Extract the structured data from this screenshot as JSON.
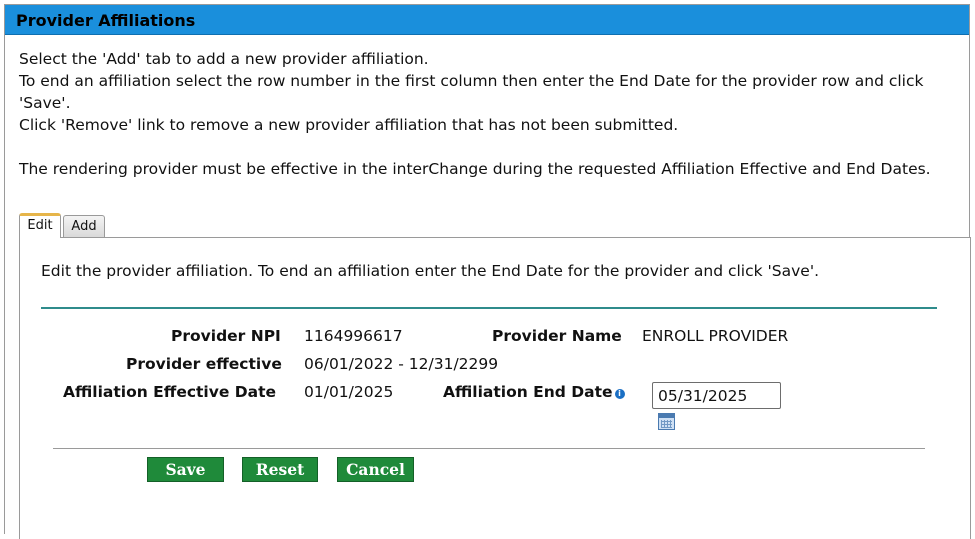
{
  "title": "Provider Affiliations",
  "intro": {
    "line1": "Select the 'Add' tab to add a new provider affiliation.",
    "line2": "To end an affiliation select the row number in the first column then enter the End Date for the provider row and click 'Save'.",
    "line3": "Click 'Remove' link to remove a new provider affiliation that has not been submitted.",
    "line4": "The rendering provider must be effective in the interChange during the requested Affiliation Effective and End Dates."
  },
  "tabs": {
    "edit": "Edit",
    "add": "Add"
  },
  "panel": {
    "description": "Edit the provider affiliation. To end an affiliation enter the End Date for the provider and click 'Save'.",
    "provider_npi_label": "Provider NPI",
    "provider_npi": "1164996617",
    "provider_name_label": "Provider Name",
    "provider_name": "ENROLL PROVIDER",
    "provider_effective_label": "Provider effective",
    "provider_effective": "06/01/2022 - 12/31/2299",
    "affiliation_effective_label": "Affiliation Effective Date",
    "affiliation_effective": "01/01/2025",
    "affiliation_end_label": "Affiliation End Date",
    "affiliation_end_value": "05/31/2025"
  },
  "buttons": {
    "save": "Save",
    "reset": "Reset",
    "cancel": "Cancel"
  },
  "icons": {
    "info": "info-icon",
    "calendar": "calendar-icon"
  },
  "colors": {
    "title_bar": "#1a8fdc",
    "button": "#1f8a3a",
    "divider": "#2f8c8c",
    "active_tab": "#e6b54a"
  }
}
